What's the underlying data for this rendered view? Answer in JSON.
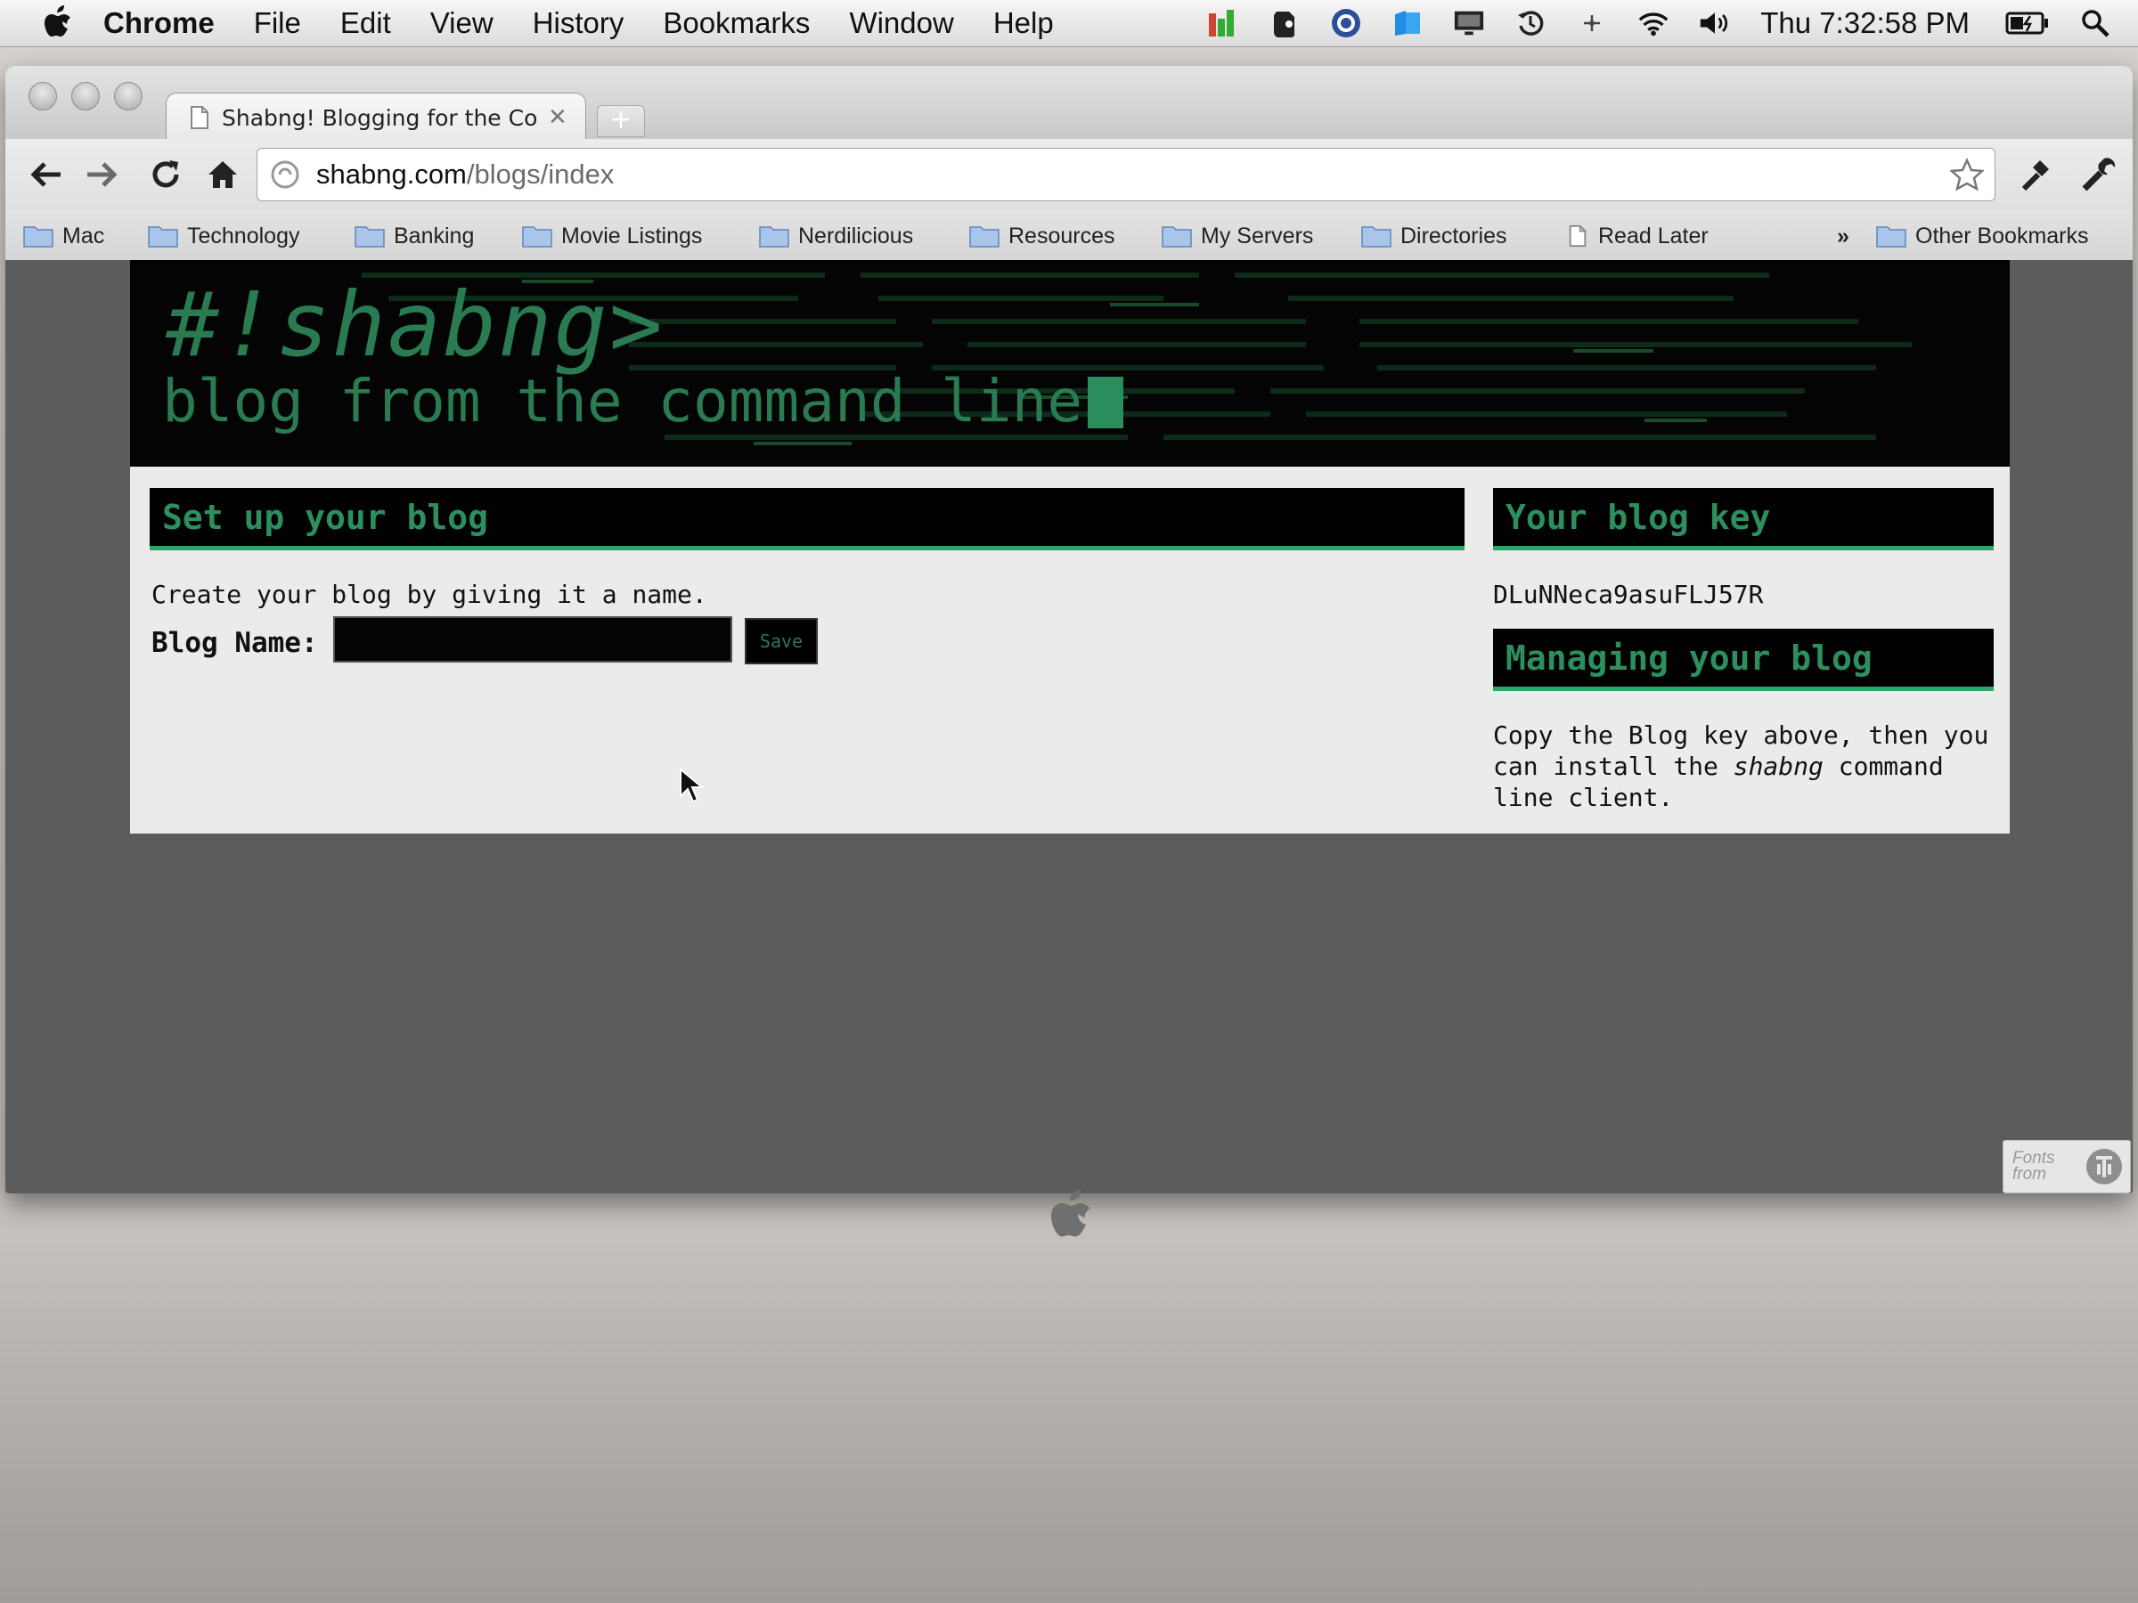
{
  "menubar": {
    "app": "Chrome",
    "items": [
      "File",
      "Edit",
      "View",
      "History",
      "Bookmarks",
      "Window",
      "Help"
    ],
    "clock": "Thu 7:32:58 PM",
    "status_icons": [
      "istat-menus-icon",
      "evernote-icon",
      "screen-capture-icon",
      "dropbox-icon",
      "display-icon",
      "time-machine-icon",
      "bluetooth-icon",
      "wifi-icon",
      "volume-icon",
      "battery-icon",
      "spotlight-icon"
    ]
  },
  "browser": {
    "tab_title": "Shabng! Blogging for the Co",
    "tab_close": "✕",
    "newtab": "+",
    "url_host": "shabng.com",
    "url_path": "/blogs/index"
  },
  "bookmarks": {
    "items": [
      {
        "label": "Mac"
      },
      {
        "label": "Technology"
      },
      {
        "label": "Banking"
      },
      {
        "label": "Movie Listings"
      },
      {
        "label": "Nerdilicious"
      },
      {
        "label": "Resources"
      },
      {
        "label": "My Servers"
      },
      {
        "label": "Directories"
      },
      {
        "label": "Read Later"
      }
    ],
    "overflow": "»",
    "other": "Other Bookmarks"
  },
  "site": {
    "logo": "#!shabng>",
    "tagline": "blog from the command line",
    "setup": {
      "heading": "Set up your blog",
      "intro": "Create your blog by giving it a name.",
      "field_label": "Blog Name:",
      "field_value": "",
      "save_label": "Save"
    },
    "key": {
      "heading": "Your blog key",
      "value": "DLuNNeca9asuFLJ57R"
    },
    "manage": {
      "heading": "Managing your blog",
      "text_before": "Copy the Blog key above, then you can install the ",
      "text_em": "shabng",
      "text_after": " command line client."
    }
  },
  "badge": {
    "line1": "Fonts",
    "line2": "from"
  },
  "colors": {
    "accent_green": "#2a7a52",
    "header_bg": "#030403",
    "content_bg": "#ebebeb"
  }
}
